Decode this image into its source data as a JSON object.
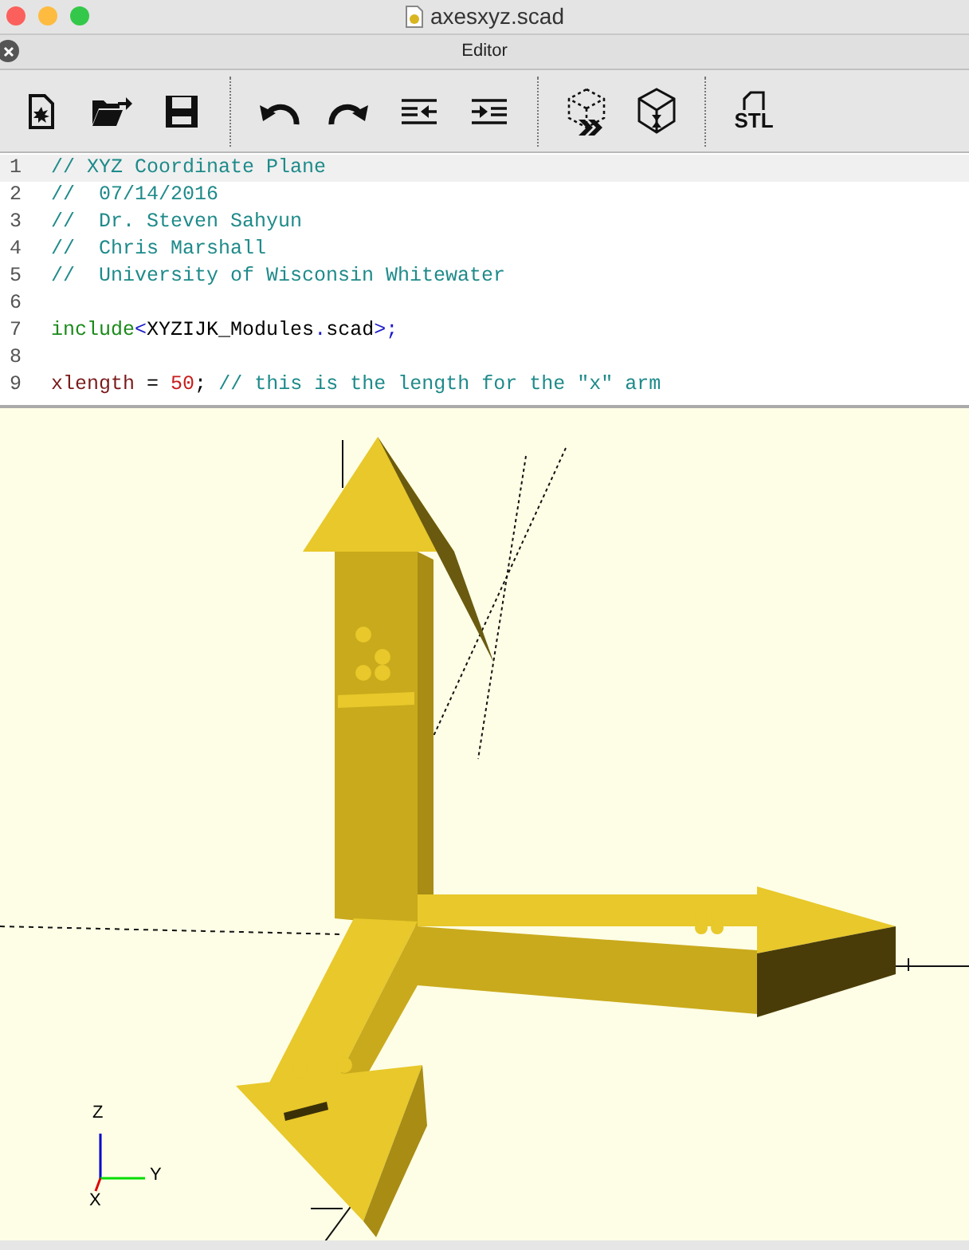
{
  "window": {
    "title": "axesxyz.scad"
  },
  "editor_panel": {
    "title": "Editor"
  },
  "toolbar": [
    {
      "kind": "new"
    },
    {
      "kind": "open"
    },
    {
      "kind": "save"
    },
    {
      "kind": "separator"
    },
    {
      "kind": "undo"
    },
    {
      "kind": "redo"
    },
    {
      "kind": "unindent"
    },
    {
      "kind": "indent"
    },
    {
      "kind": "separator"
    },
    {
      "kind": "preview"
    },
    {
      "kind": "render"
    },
    {
      "kind": "separator"
    },
    {
      "kind": "export",
      "label": "STL"
    }
  ],
  "code_lines": [
    {
      "number": "1",
      "selected": true,
      "tokens": [
        {
          "kind": "comment",
          "text": "// XYZ Coordinate Plane"
        }
      ]
    },
    {
      "number": "2",
      "selected": false,
      "tokens": [
        {
          "kind": "comment",
          "text": "//  07/14/2016"
        }
      ]
    },
    {
      "number": "3",
      "selected": false,
      "tokens": [
        {
          "kind": "comment",
          "text": "//  Dr. Steven Sahyun"
        }
      ]
    },
    {
      "number": "4",
      "selected": false,
      "tokens": [
        {
          "kind": "comment",
          "text": "//  Chris Marshall"
        }
      ]
    },
    {
      "number": "5",
      "selected": false,
      "tokens": [
        {
          "kind": "comment",
          "text": "//  University of Wisconsin Whitewater"
        }
      ]
    },
    {
      "number": "6",
      "selected": false
    },
    {
      "number": "7",
      "selected": false,
      "tokens": [
        {
          "kind": "keyword",
          "text": "include"
        },
        {
          "kind": "operator",
          "text": "<"
        },
        {
          "kind": "plain",
          "text": "XYZIJK_Modules"
        },
        {
          "kind": "operator",
          "text": "."
        },
        {
          "kind": "plain",
          "text": "scad"
        },
        {
          "kind": "operator",
          "text": ">;"
        }
      ]
    },
    {
      "number": "8",
      "selected": false
    },
    {
      "number": "9",
      "selected": false,
      "tokens": [
        {
          "kind": "variable",
          "text": "xlength"
        },
        {
          "kind": "plain",
          "text": " = "
        },
        {
          "kind": "number",
          "text": "50"
        },
        {
          "kind": "plain",
          "text": "; "
        },
        {
          "kind": "comment",
          "text": "// this is the length for the \"x\" arm"
        }
      ]
    }
  ],
  "viewport": {
    "axis_labels": {
      "z": "Z",
      "y": "Y",
      "x": "X"
    }
  }
}
